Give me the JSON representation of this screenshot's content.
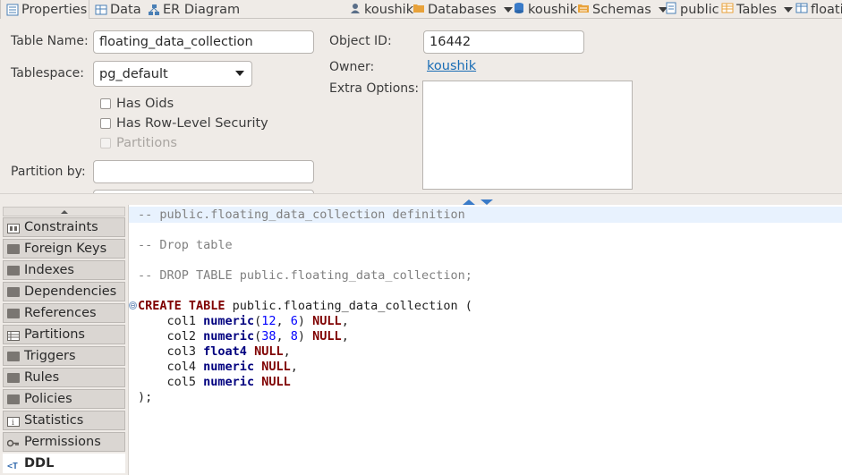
{
  "tabs": [
    {
      "label": "Properties",
      "icon": "properties-icon"
    },
    {
      "label": "Data",
      "icon": "data-grid-icon"
    },
    {
      "label": "ER Diagram",
      "icon": "er-diagram-icon"
    }
  ],
  "breadcrumbs": [
    {
      "label": "koushik",
      "icon": "user-icon",
      "dropdown": false
    },
    {
      "label": "Databases",
      "icon": "folder-icon",
      "dropdown": true
    },
    {
      "label": "koushik",
      "icon": "database-icon",
      "dropdown": false
    },
    {
      "label": "Schemas",
      "icon": "schemas-icon",
      "dropdown": true
    },
    {
      "label": "public",
      "icon": "schema-icon",
      "dropdown": false
    },
    {
      "label": "Tables",
      "icon": "tables-icon",
      "dropdown": true
    },
    {
      "label": "floati",
      "icon": "table-icon",
      "dropdown": false
    }
  ],
  "form": {
    "table_name_label": "Table Name:",
    "table_name_value": "floating_data_collection",
    "tablespace_label": "Tablespace:",
    "tablespace_value": "pg_default",
    "has_oids_label": "Has Oids",
    "row_security_label": "Has Row-Level Security",
    "partitions_label": "Partitions",
    "partition_by_label": "Partition by:",
    "partition_by_value": "",
    "object_id_label": "Object ID:",
    "object_id_value": "16442",
    "owner_label": "Owner:",
    "owner_value": "koushik",
    "extra_options_label": "Extra Options:",
    "extra_options_value": ""
  },
  "nav": {
    "items": [
      {
        "label": "Constraints",
        "icon": "constraints-icon",
        "selected": false
      },
      {
        "label": "Foreign Keys",
        "icon": "folder-icon",
        "selected": false
      },
      {
        "label": "Indexes",
        "icon": "folder-icon",
        "selected": false
      },
      {
        "label": "Dependencies",
        "icon": "folder-icon",
        "selected": false
      },
      {
        "label": "References",
        "icon": "folder-icon",
        "selected": false
      },
      {
        "label": "Partitions",
        "icon": "partitions-icon",
        "selected": false
      },
      {
        "label": "Triggers",
        "icon": "folder-icon",
        "selected": false
      },
      {
        "label": "Rules",
        "icon": "folder-icon",
        "selected": false
      },
      {
        "label": "Policies",
        "icon": "folder-icon",
        "selected": false
      },
      {
        "label": "Statistics",
        "icon": "info-icon",
        "selected": false
      },
      {
        "label": "Permissions",
        "icon": "key-icon",
        "selected": false
      },
      {
        "label": "DDL",
        "icon": "ddl-icon",
        "selected": true
      }
    ]
  },
  "ddl": {
    "comment1": "-- public.floating_data_collection definition",
    "comment2": "-- Drop table",
    "comment3": "-- DROP TABLE public.floating_data_collection;",
    "create_kw": "CREATE TABLE",
    "create_name": " public.floating_data_collection (",
    "cols": [
      {
        "name": "col1",
        "type": "numeric",
        "args_open": "(",
        "a1": "12",
        "sep": ", ",
        "a2": "6",
        "args_close": ")",
        "null_kw": "NULL",
        "trail": ","
      },
      {
        "name": "col2",
        "type": "numeric",
        "args_open": "(",
        "a1": "38",
        "sep": ", ",
        "a2": "8",
        "args_close": ")",
        "null_kw": "NULL",
        "trail": ","
      },
      {
        "name": "col3",
        "type": "float4",
        "null_kw": "NULL",
        "trail": ","
      },
      {
        "name": "col4",
        "type": "numeric",
        "null_kw": "NULL",
        "trail": ","
      },
      {
        "name": "col5",
        "type": "numeric",
        "null_kw": "NULL",
        "trail": ""
      }
    ],
    "close": ");",
    "fold_symbol": "⊖"
  }
}
